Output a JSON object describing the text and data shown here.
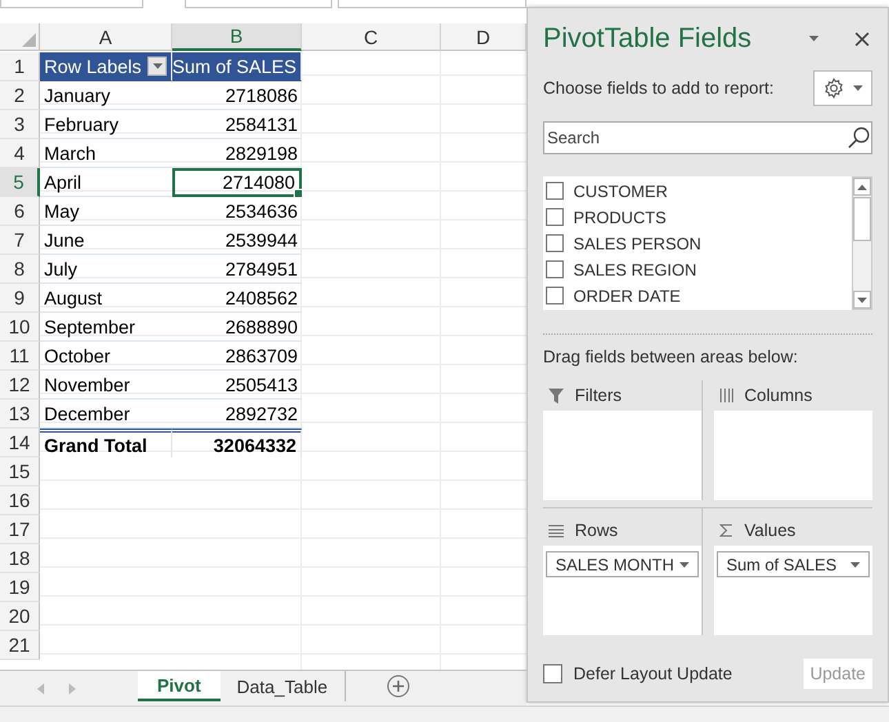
{
  "sheet": {
    "columns": [
      {
        "label": "A",
        "selected": false
      },
      {
        "label": "B",
        "selected": true
      },
      {
        "label": "C",
        "selected": false
      },
      {
        "label": "D",
        "selected": false
      }
    ],
    "row_numbers": [
      "1",
      "2",
      "3",
      "4",
      "5",
      "6",
      "7",
      "8",
      "9",
      "10",
      "11",
      "12",
      "13",
      "14",
      "15",
      "16",
      "17",
      "18",
      "19",
      "20",
      "21"
    ],
    "pivot": {
      "header": {
        "row_labels": "Row Labels",
        "values": "Sum of SALES"
      },
      "rows": [
        {
          "label": "January",
          "value": "2718086",
          "selected": false
        },
        {
          "label": "February",
          "value": "2584131",
          "selected": false
        },
        {
          "label": "March",
          "value": "2829198",
          "selected": false
        },
        {
          "label": "April",
          "value": "2714080",
          "selected": true
        },
        {
          "label": "May",
          "value": "2534636",
          "selected": false
        },
        {
          "label": "June",
          "value": "2539944",
          "selected": false
        },
        {
          "label": "July",
          "value": "2784951",
          "selected": false
        },
        {
          "label": "August",
          "value": "2408562",
          "selected": false
        },
        {
          "label": "September",
          "value": "2688890",
          "selected": false
        },
        {
          "label": "October",
          "value": "2863709",
          "selected": false
        },
        {
          "label": "November",
          "value": "2505413",
          "selected": false
        },
        {
          "label": "December",
          "value": "2892732",
          "selected": false
        }
      ],
      "total": {
        "label": "Grand Total",
        "value": "32064332"
      }
    }
  },
  "sheet_tabs": [
    {
      "label": "Pivot",
      "selected": true
    },
    {
      "label": "Data_Table",
      "selected": false
    }
  ],
  "panel": {
    "title": "PivotTable Fields",
    "choose_label": "Choose fields to add to report:",
    "search": {
      "placeholder": "Search"
    },
    "fields": [
      {
        "label": "CUSTOMER",
        "checked": false
      },
      {
        "label": "PRODUCTS",
        "checked": false
      },
      {
        "label": "SALES PERSON",
        "checked": false
      },
      {
        "label": "SALES REGION",
        "checked": false
      },
      {
        "label": "ORDER DATE",
        "checked": false
      }
    ],
    "drag_label": "Drag fields between areas below:",
    "areas": [
      {
        "kind": "filters",
        "label": "Filters"
      },
      {
        "kind": "columns",
        "label": "Columns"
      },
      {
        "kind": "rows",
        "label": "Rows",
        "items": [
          "SALES MONTH"
        ]
      },
      {
        "kind": "values",
        "label": "Values",
        "items": [
          "Sum of SALES"
        ]
      }
    ],
    "defer": {
      "label": "Defer Layout Update",
      "checked": false
    },
    "update_button": {
      "label": "Update",
      "disabled": true
    }
  }
}
